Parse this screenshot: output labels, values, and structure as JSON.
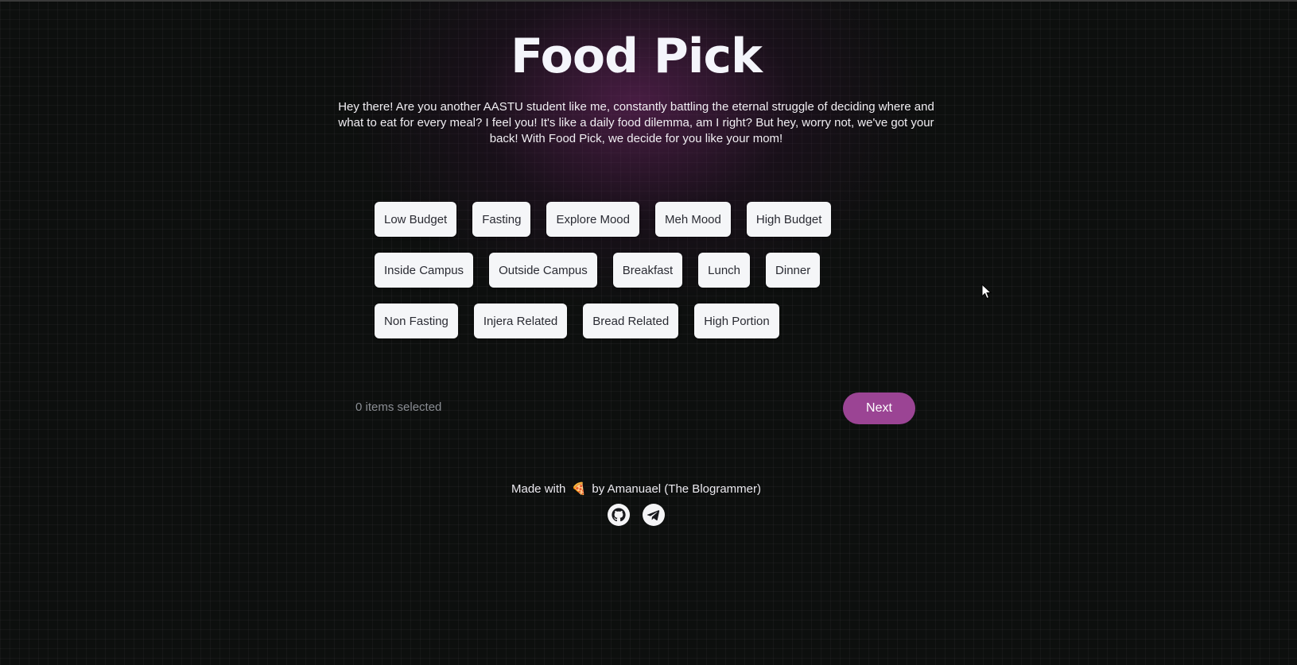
{
  "header": {
    "title": "Food Pick",
    "intro": "Hey there! Are you another AASTU student like me, constantly battling the eternal struggle of deciding where and what to eat for every meal? I feel you! It's like a daily food dilemma, am I right? But hey, worry not, we've got your back! With Food Pick, we decide for you like your mom!"
  },
  "filters": {
    "row1": [
      "Low Budget",
      "Fasting",
      "Explore Mood",
      "Meh Mood",
      "High Budget"
    ],
    "row2": [
      "Inside Campus",
      "Outside Campus",
      "Breakfast",
      "Lunch",
      "Dinner"
    ],
    "row3": [
      "Non Fasting",
      "Injera Related",
      "Bread Related",
      "High Portion"
    ]
  },
  "selection": {
    "count_text": "0 items selected",
    "next_label": "Next"
  },
  "footer": {
    "made_with": "Made with",
    "emoji": "🍕",
    "by_text": "by Amanuael (The Blogrammer)",
    "socials": [
      "github-icon",
      "telegram-icon"
    ]
  },
  "colors": {
    "accent": "#9b4494",
    "chip_bg": "#f5f6f8",
    "background": "#0d0f0e"
  }
}
